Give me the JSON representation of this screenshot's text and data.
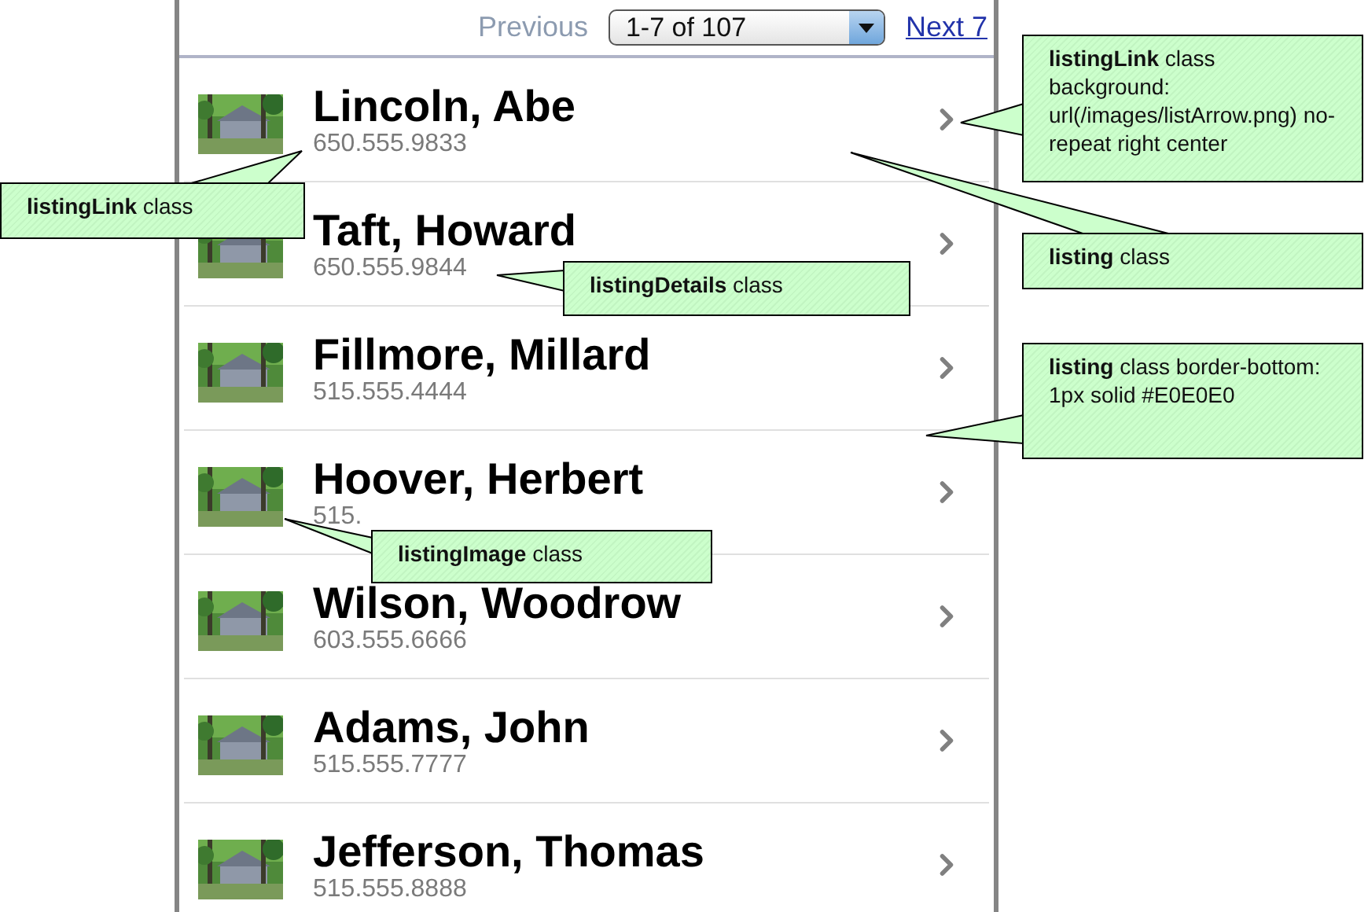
{
  "pager": {
    "previous": "Previous",
    "range": "1-7 of 107",
    "next": "Next 7"
  },
  "listings": [
    {
      "name": "Lincoln, Abe",
      "phone": "650.555.9833"
    },
    {
      "name": "Taft, Howard",
      "phone": "650.555.9844"
    },
    {
      "name": "Fillmore, Millard",
      "phone": "515.555.4444"
    },
    {
      "name": "Hoover, Herbert",
      "phone": "515."
    },
    {
      "name": "Wilson, Woodrow",
      "phone": "603.555.6666"
    },
    {
      "name": "Adams, John",
      "phone": "515.555.7777"
    },
    {
      "name": "Jefferson, Thomas",
      "phone": "515.555.8888"
    }
  ],
  "callouts": [
    {
      "text": "**listingLink** class"
    },
    {
      "text": "**listingDetails** class"
    },
    {
      "text": "**listingImage** class"
    },
    {
      "text": "**listingLink** class background: url(/images/listArrow.png) no-repeat right center"
    },
    {
      "text": "**listing** class"
    },
    {
      "text": "**listing** class border-bottom:  1px solid #E0E0E0"
    }
  ]
}
